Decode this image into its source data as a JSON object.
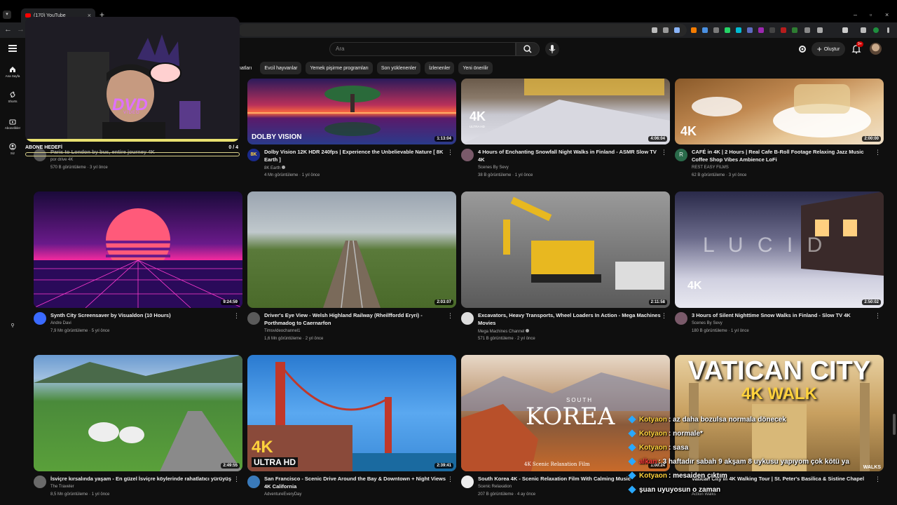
{
  "browser": {
    "tab_title": "(170) YouTube",
    "new_tab": "+",
    "close_tab": "×",
    "window_controls": [
      "–",
      "▫",
      "×"
    ]
  },
  "header": {
    "search_placeholder": "Ara",
    "create_label": "Oluştur",
    "notification_count": "9+"
  },
  "rail": [
    {
      "label": "Ana Sayfa",
      "icon": "home-icon"
    },
    {
      "label": "Shorts",
      "icon": "shorts-icon"
    },
    {
      "label": "Abonelikler",
      "icon": "subscriptions-icon"
    },
    {
      "label": "Siz",
      "icon": "you-icon"
    }
  ],
  "chips": [
    "matları",
    "Evcil hayvanlar",
    "Yemek pişirme programları",
    "Son yüklenenler",
    "İzlenenler",
    "Yeni önerilir"
  ],
  "videos": [
    {
      "title": "Paris to London by bus, entire journey 4K",
      "channel": "por drive 4K",
      "stats": "570 B görüntüleme · 3 yıl önce",
      "duration": "",
      "verified": false
    },
    {
      "title": "Dolby Vision 12K HDR 240fps | Experience the Unbelievable Nature [ 8K Earth ]",
      "channel": "8K Earth",
      "stats": "4 Mn görüntüleme · 1 yıl önce",
      "duration": "1:13:04",
      "verified": true
    },
    {
      "title": "4 Hours of Enchanting Snowfall Night Walks in Finland - ASMR Slow TV 4K",
      "channel": "Scenes By Sevy",
      "stats": "38 B görüntüleme · 1 yıl önce",
      "duration": "4:06:04",
      "verified": false
    },
    {
      "title": "CAFÉ in 4K | 2 Hours | Real Cafe B-Roll Footage Relaxing Jazz Music Coffee Shop Vibes Ambience LoFi",
      "channel": "REST EASY FILMS",
      "stats": "62 B görüntüleme · 3 yıl önce",
      "duration": "2:00:00",
      "verified": false
    },
    {
      "title": "Synth City Screensaver by Visualdon (10 Hours)",
      "channel": "Andre Davi",
      "stats": "7,9 Mn görüntüleme · 5 yıl önce",
      "duration": "9:24:59",
      "verified": false
    },
    {
      "title": "Driver's Eye View - Welsh Highland Railway (Rheilffordd Eryri) - Porthmadog to Caernarfon",
      "channel": "Timsvideochannel1",
      "stats": "1,6 Mn görüntüleme · 2 yıl önce",
      "duration": "2:03:07",
      "verified": false
    },
    {
      "title": "Excavators, Heavy Transports, Wheel Loaders In Action - Mega Machines Movies",
      "channel": "Mega Machines Channel",
      "stats": "571 B görüntüleme · 2 yıl önce",
      "duration": "2:11:58",
      "verified": true
    },
    {
      "title": "3 Hours of Silent Nighttime Snow Walks in Finland - Slow TV 4K",
      "channel": "Scenes By Sevy",
      "stats": "180 B görüntüleme · 1 yıl önce",
      "duration": "2:50:02",
      "verified": false
    },
    {
      "title": "İsviçre kırsalında yaşam - En güzel İsviçre köylerinde rahatlatıcı yürüyüş",
      "channel": "The Traveler",
      "stats": "8,5 Mn görüntüleme · 1 yıl önce",
      "duration": "2:49:55",
      "verified": false
    },
    {
      "title": "San Francisco - Scenic Drive Around the Bay & Downtown + Night Views 4K California",
      "channel": "AdventureEveryDay",
      "stats": "",
      "duration": "2:39:41",
      "verified": false
    },
    {
      "title": "South Korea 4K - Scenic Relaxation Film With Calming Music",
      "channel": "Scenic Relaxation",
      "stats": "207 B görüntüleme · 4 ay önce",
      "duration": "1:00:24",
      "verified": false
    },
    {
      "title": "Vatican City in 4K Walking Tour | St. Peter's Basilica & Sistine Chapel",
      "channel": "Action Walks",
      "stats": "",
      "duration": "",
      "verified": false
    }
  ],
  "thumb_text": {
    "dolby": "DOLBY VISION",
    "k4": "4K",
    "k4_ultra": "ULTRA HD",
    "lucid": "L U C I D",
    "korea_small": "SOUTH",
    "korea": "KOREA",
    "korea_sub": "4K Scenic Relaxation Film",
    "vatican1": "VATICAN CITY",
    "vatican2": "4K WALK",
    "sf_4k": "4K",
    "sf_ultra": "ULTRA HD",
    "walks": "WALKS"
  },
  "webcam": {
    "dvd": "DVD",
    "dvd_video": "VIDEO",
    "goal_label": "ABONE HEDEFİ",
    "goal_count": "0 / 4",
    "goal_progress": 0
  },
  "chat": [
    {
      "user": "Kotyaon",
      "text": ": az daha bozulsa normala dönecek",
      "style": "normal"
    },
    {
      "user": "Kotyaon",
      "text": ": normale*",
      "style": "normal"
    },
    {
      "user": "Kotyaon",
      "text": ": sasa",
      "style": "normal"
    },
    {
      "user": "alkan",
      "text": ": 3 haftadır sabah 9 akşam 8 uykusu yapıyom çok kötü ya",
      "style": "red"
    },
    {
      "user": "Kotyaon",
      "text": ": mesaiden çıktım",
      "style": "normal"
    },
    {
      "user": "",
      "text": "şuan uyuyosun o zaman",
      "style": "cyan"
    }
  ]
}
